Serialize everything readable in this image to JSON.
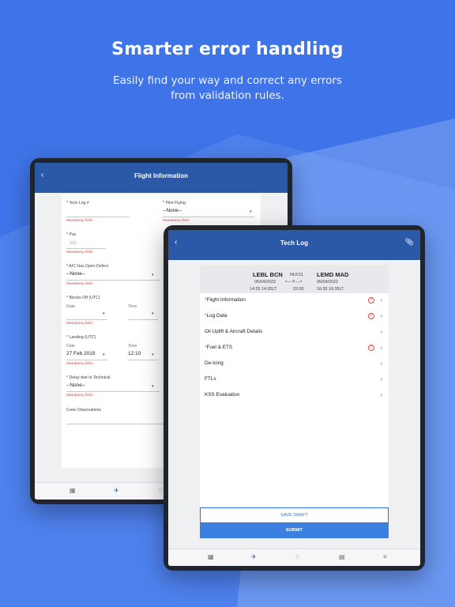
{
  "promo": {
    "title": "Smarter error handling",
    "subtitle_line1": "Easily find your way and correct any errors",
    "subtitle_line2": "from validation rules."
  },
  "colors": {
    "background": "#3f74e8",
    "appbar": "#2c58a8",
    "error": "#d64545",
    "submit": "#3b7fe0"
  },
  "flight_info_screen": {
    "title": "Flight Information",
    "fields": {
      "tech_log": {
        "label": "* Tech Log #",
        "error": "Mandatory field"
      },
      "pilot_flying": {
        "label": "* Pilot Flying",
        "value": "--None--",
        "error": "Mandatory field"
      },
      "pax": {
        "label": "* Pax",
        "placeholder": "000",
        "error": "Mandatory field"
      },
      "open_defect": {
        "label": "* A/C Has Open Defect",
        "value": "--None--",
        "error": "Mandatory field"
      },
      "blocks_off": {
        "label": "* Blocks Off (UTC)",
        "date_label": "Date",
        "time_label": "Time",
        "error": "Mandatory field"
      },
      "landing": {
        "label": "* Landing (UTC)",
        "date_label": "Date",
        "date_value": "27 Feb 2019",
        "time_label": "Time",
        "time_value": "12:10",
        "error": "Mandatory field"
      },
      "delay": {
        "label": "* Delay due to Technical",
        "value": "--None--",
        "error": "Mandatory field"
      },
      "crew_obs": {
        "label": "Crew Observations"
      }
    }
  },
  "tech_log_screen": {
    "title": "Tech Log",
    "flight": {
      "origin": "LEBL BCN",
      "origin_date": "05/04/2022",
      "origin_time": "14:35 14:35LT",
      "flight_no": "NUV11",
      "duration": "02:00",
      "dest": "LEMD MAD",
      "dest_date": "05/04/2022",
      "dest_time": "16:35 16:35LT"
    },
    "sections": [
      {
        "label": "Flight Information",
        "required": "*",
        "error": "!"
      },
      {
        "label": "Log Data",
        "required": "*",
        "error": "!"
      },
      {
        "label": "Oil Uplift & Aircraft Details",
        "required": "",
        "error": ""
      },
      {
        "label": "Fuel & ETS",
        "required": "*",
        "error": "!"
      },
      {
        "label": "De-Icing",
        "required": "",
        "error": ""
      },
      {
        "label": "FTLs",
        "required": "",
        "error": ""
      },
      {
        "label": "KSS Evaluation",
        "required": "",
        "error": ""
      }
    ],
    "save_draft": "SAVE DRAFT",
    "submit": "SUBMIT"
  },
  "tabs": [
    "calendar-icon",
    "plane-icon",
    "bell-icon",
    "clipboard-icon",
    "menu-icon"
  ]
}
